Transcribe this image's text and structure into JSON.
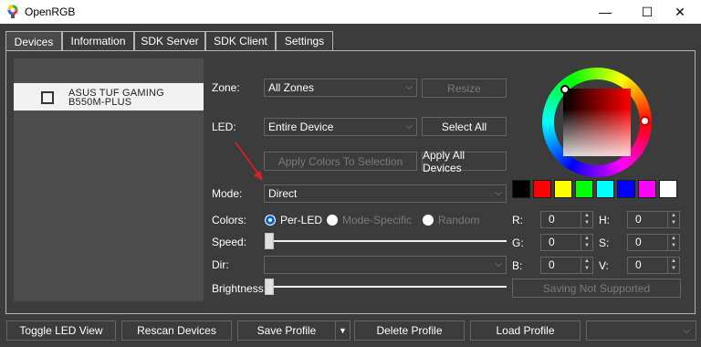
{
  "window": {
    "title": "OpenRGB",
    "minimize_glyph": "—",
    "maximize_glyph": "☐",
    "close_glyph": "✕"
  },
  "tabs": [
    {
      "label": "Devices"
    },
    {
      "label": "Information"
    },
    {
      "label": "SDK Server"
    },
    {
      "label": "SDK Client"
    },
    {
      "label": "Settings"
    }
  ],
  "device_list": {
    "items": [
      {
        "line1": "ASUS TUF GAMING",
        "line2": "B550M-PLUS"
      }
    ]
  },
  "controls": {
    "zone_label": "Zone:",
    "zone_value": "All Zones",
    "resize_label": "Resize",
    "led_label": "LED:",
    "led_value": "Entire Device",
    "select_all_label": "Select All",
    "apply_colors_label": "Apply Colors To Selection",
    "apply_all_label": "Apply All Devices",
    "mode_label": "Mode:",
    "mode_value": "Direct",
    "colors_label": "Colors:",
    "radio_per_led": "Per-LED",
    "radio_mode_specific": "Mode-Specific",
    "radio_random": "Random",
    "speed_label": "Speed:",
    "dir_label": "Dir:",
    "dir_value": "",
    "brightness_label": "Brightness:",
    "saving_label": "Saving Not Supported"
  },
  "color_values": {
    "r_label": "R:",
    "r_value": "0",
    "g_label": "G:",
    "g_value": "0",
    "b_label": "B:",
    "b_value": "0",
    "h_label": "H:",
    "h_value": "0",
    "s_label": "S:",
    "s_value": "0",
    "v_label": "V:",
    "v_value": "0"
  },
  "swatches": [
    "#000000",
    "#ff0000",
    "#ffff00",
    "#00ff00",
    "#00ffff",
    "#0000ff",
    "#ff00ff",
    "#ffffff"
  ],
  "bottom_bar": {
    "toggle_led_view": "Toggle LED View",
    "rescan_devices": "Rescan Devices",
    "save_profile": "Save Profile",
    "delete_profile": "Delete Profile",
    "load_profile": "Load Profile",
    "profile_select_value": ""
  }
}
